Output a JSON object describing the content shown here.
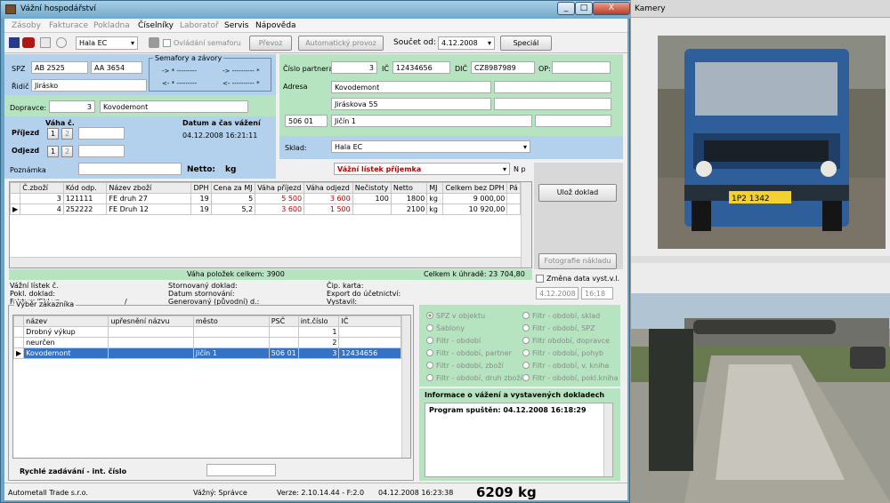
{
  "window_title": "Vážní hospodářství",
  "caption_buttons": [
    "_",
    "□",
    "X"
  ],
  "menu": [
    "Zásoby",
    "Fakturace",
    "Pokladna",
    "Číselníky",
    "Laboratoř",
    "Servis",
    "Nápověda"
  ],
  "toolbar": {
    "hall": "Hala EC",
    "semaphore": "Ovládání semaforu",
    "transfer": "Převoz",
    "auto": "Automatický provoz",
    "sum_label": "Součet od:",
    "sum_date": "4.12.2008",
    "special": "Speciál"
  },
  "vehicle": {
    "spz_label": "SPZ",
    "spz1": "AB 2525",
    "spz2": "AA 3654",
    "driver_label": "Řidič",
    "driver": "Jirásko",
    "carrier_label": "Dopravce:",
    "carrier_no": "3",
    "carrier": "Kovodemont",
    "sema_title": "Semafory a závory",
    "sema": [
      "-> * ---------",
      "-> ---------- *",
      "<- * ---------",
      "<- ---------- *"
    ]
  },
  "partner": {
    "no_label": "Číslo partnera",
    "no": "3",
    "ic_label": "IČ",
    "ic": "12434656",
    "dic_label": "DIČ",
    "dic": "CZ8987989",
    "op_label": "OP:",
    "addr_label": "Adresa",
    "name": "Kovodemont",
    "street": "Jiráskova 55",
    "zip": "506 01",
    "city": "Jičín 1",
    "store_label": "Sklad:",
    "store": "Hala EC"
  },
  "weighing": {
    "weight_no": "Váha č.",
    "arrival": "Příjezd",
    "departure": "Odjezd",
    "dt_label": "Datum a čas vážení",
    "dt": "04.12.2008 16:21:11",
    "note": "Poznámka",
    "netto": "Netto:",
    "kg": "kg",
    "one": "1",
    "two": "2"
  },
  "slip": {
    "type": "Vážní lístek příjemka",
    "np": "N p",
    "save": "Ulož doklad",
    "photos": "Fotografie nákladu"
  },
  "items": {
    "headers": [
      "Č.zboží",
      "Kód odp.",
      "Název zboží",
      "DPH",
      "Cena za MJ",
      "Váha příjezd",
      "Váha odjezd",
      "Nečistoty",
      "Netto",
      "MJ",
      "Celkem bez DPH",
      "Pá"
    ],
    "rows": [
      [
        "3",
        "121111",
        "FE druh 27",
        "19",
        "5",
        "5 500",
        "3 600",
        "100",
        "1800",
        "kg",
        "9 000,00",
        ""
      ],
      [
        "4",
        "252222",
        "FE Druh 12",
        "19",
        "5,2",
        "3 600",
        "1 500",
        "",
        "2100",
        "kg",
        "10 920,00",
        ""
      ]
    ],
    "total_weight": "Váha položek celkem:  3900",
    "total_pay": "Celkem k úhradě:  23 704,80"
  },
  "info": {
    "c1": [
      "Vážní lístek č.",
      "Pokl. doklad:",
      "Faktura/Skl.vz:"
    ],
    "slash": "/",
    "c2": [
      "Stornovaný doklad:",
      "Datum stornování:",
      "Generovaný (původní) d.:"
    ],
    "c3": [
      "Čip. karta:",
      "Export do účetnictví:",
      "Vystavil:"
    ],
    "change_date": "Změna data vyst.v.l.",
    "date": "4.12.2008",
    "time": "16:18"
  },
  "customers": {
    "title": "Výběr zákazníka",
    "headers": [
      "název",
      "upřesnění názvu",
      "město",
      "PSČ",
      "int.číslo",
      "IČ"
    ],
    "rows": [
      [
        "Drobný výkup",
        "",
        "",
        "",
        "1",
        ""
      ],
      [
        "neurčen",
        "",
        "",
        "",
        "2",
        ""
      ],
      [
        "Kovodemont",
        "",
        "Jičín 1",
        "506 01",
        "3",
        "12434656"
      ]
    ],
    "quick": "Rychlé zadávání - int. číslo"
  },
  "filters": {
    "left": [
      "SPZ v objektu",
      "Šablony",
      "Filtr - období",
      "Filtr - období, partner",
      "Filtr - období, zboží",
      "Filtr - období, druh zboží"
    ],
    "right": [
      "Filtr - období, sklad",
      "Filtr - období, SPZ",
      "Filtr období, dopravce",
      "Filtr - období, pohyb",
      "Filtr - období, v. kniha",
      "Filtr - období, pokl.kniha"
    ]
  },
  "log": {
    "title": "Informace o vážení a vystavených dokladech",
    "line": "Program spuštěn: 04.12.2008 16:18:29"
  },
  "status": {
    "company": "Autometall Trade s.r.o.",
    "user": "Vážný: Správce",
    "version": "Verze: 2.10.14.44 - F:2.0",
    "datetime": "04.12.2008 16:23:38",
    "weight": "6209 kg"
  },
  "cameras": {
    "title": "Kamery",
    "plate": "1P2 1342"
  }
}
